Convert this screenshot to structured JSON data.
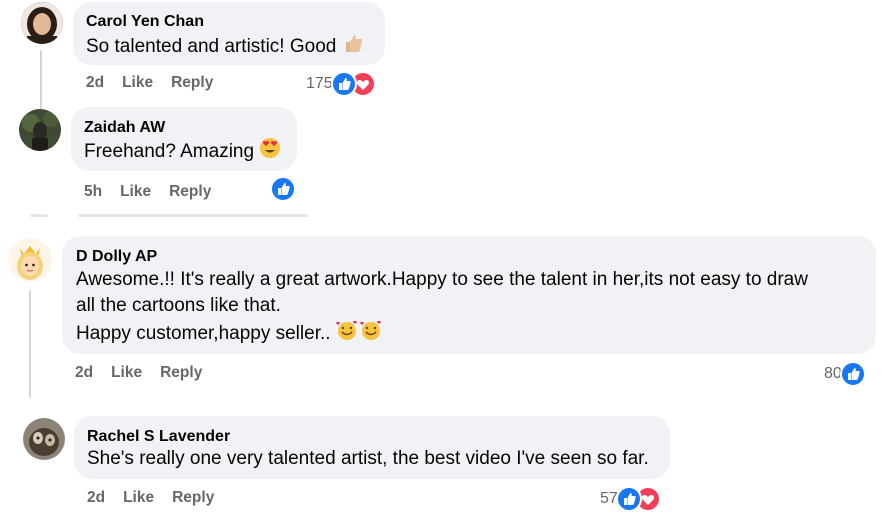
{
  "comments": [
    {
      "author": "Carol Yen Chan",
      "text": "So talented and artistic! Good",
      "time": "2d",
      "like_label": "Like",
      "reply_label": "Reply",
      "reaction_count": "175",
      "reactions": [
        "like-icon",
        "love-icon"
      ]
    },
    {
      "author": "Zaidah AW",
      "text": "Freehand? Amazing",
      "time": "5h",
      "like_label": "Like",
      "reply_label": "Reply",
      "reaction_count": "",
      "reactions": [
        "like-icon"
      ]
    },
    {
      "author": "D Dolly AP",
      "text_line1": "Awesome.!! It's really a great artwork.Happy to see the talent in her,its not easy to draw",
      "text_line2": "all the cartoons like that.",
      "text_line3": "Happy customer,happy seller..",
      "time": "2d",
      "like_label": "Like",
      "reply_label": "Reply",
      "reaction_count": "80",
      "reactions": [
        "like-icon"
      ]
    },
    {
      "author": "Rachel S Lavender",
      "text": "She's really one very talented artist, the best video I've seen so far.",
      "time": "2d",
      "like_label": "Like",
      "reply_label": "Reply",
      "reaction_count": "57",
      "reactions": [
        "like-icon",
        "love-icon"
      ]
    }
  ],
  "colors": {
    "bubble": "#f0f2f5",
    "like_blue": "#1877f2",
    "love_red": "#f33e58",
    "meta_gray": "#65676b"
  }
}
